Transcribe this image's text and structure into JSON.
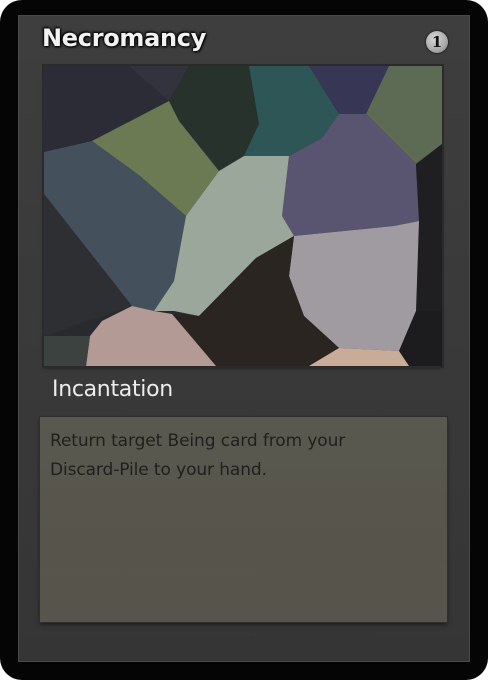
{
  "card": {
    "title": "Necromancy",
    "cost": "1",
    "type": "Incantation",
    "rules_text": [
      "Return target Being card from your",
      "Discard-Pile to your hand."
    ],
    "colors": {
      "frame": "#050505",
      "body": "#3b3b3b",
      "text_box": "#58564d",
      "title_text": "#f2f2f2",
      "cost_badge": "#b5b5b5"
    },
    "art": {
      "style": "low-poly mosaic",
      "palette": [
        "#2c2c36",
        "#333845",
        "#6b7a53",
        "#27322d",
        "#2f5656",
        "#3a3a55",
        "#5c6b55",
        "#595570",
        "#45505b",
        "#9aa79a",
        "#a09b9f",
        "#2b2521",
        "#2d2f33",
        "#b39a94",
        "#c9ac98",
        "#1f1f1f",
        "#3c423f"
      ]
    }
  }
}
